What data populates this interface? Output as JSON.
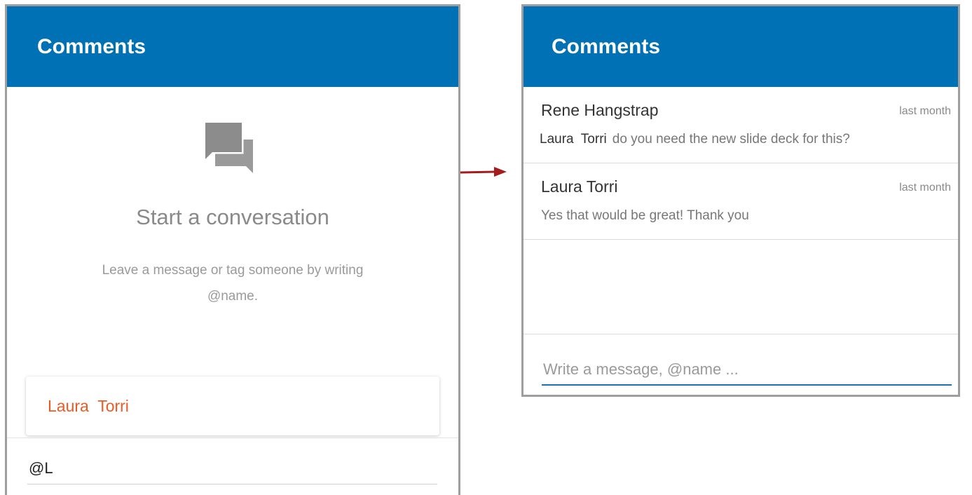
{
  "left_panel": {
    "header_title": "Comments",
    "empty_state": {
      "icon": "chat-bubbles-icon",
      "title": "Start a conversation",
      "subtitle": "Leave a message or tag someone by writing @name."
    },
    "mention_suggestion": "Laura  Torri",
    "input_value": "@L"
  },
  "right_panel": {
    "header_title": "Comments",
    "messages": [
      {
        "author": "Rene Hangstrap",
        "time": "last month",
        "mention": "Laura  Torri",
        "text": "do you need the new slide deck for this?"
      },
      {
        "author": "Laura Torri",
        "time": "last month",
        "text": "Yes that would be great! Thank you"
      }
    ],
    "input_placeholder": "Write a message, @name ..."
  },
  "colors": {
    "header_bg": "#0071b5",
    "mention_suggestion": "#ee5a24",
    "arrow": "#a61c1c",
    "input_underline": "#1a73b8"
  }
}
